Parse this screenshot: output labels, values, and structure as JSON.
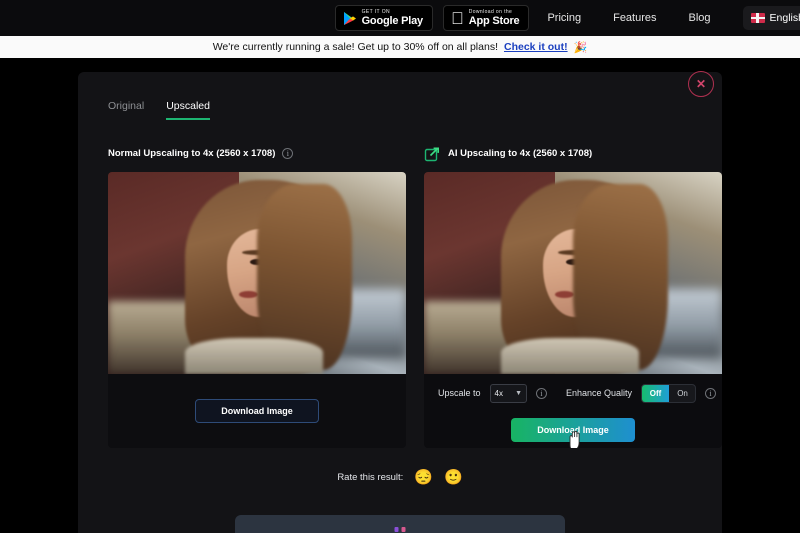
{
  "topnav": {
    "google_play": {
      "small": "GET IT ON",
      "big": "Google Play",
      "icon": "google-play-icon"
    },
    "app_store": {
      "small": "Download on the",
      "big": "App Store",
      "icon": "apple-icon"
    },
    "links": [
      "Pricing",
      "Features",
      "Blog"
    ],
    "language": {
      "label": "English",
      "flag": "uk-flag-icon"
    }
  },
  "banner": {
    "text": "We're currently running a sale! Get up to 30% off on all plans!",
    "link": "Check it out!",
    "emoji": "🎉"
  },
  "modal": {
    "close_label": "✕",
    "tabs": [
      {
        "label": "Original",
        "active": false
      },
      {
        "label": "Upscaled",
        "active": true
      }
    ],
    "left_panel": {
      "title": "Normal Upscaling to 4x (2560 x 1708)",
      "info": "i",
      "download_label": "Download Image"
    },
    "right_panel": {
      "icon": "ai-upscale-icon",
      "title": "AI Upscaling to 4x (2560 x 1708)",
      "upscale_label": "Upscale to",
      "upscale_value": "4x",
      "upscale_chevron": "▼",
      "upscale_info": "i",
      "enhance_label": "Enhance Quality",
      "enhance_off": "Off",
      "enhance_on": "On",
      "enhance_selected": "Off",
      "enhance_info": "i",
      "download_label": "Download Image"
    },
    "rate": {
      "label": "Rate this result:",
      "emoji_one": "😔",
      "emoji_two": "🙂"
    }
  },
  "colors": {
    "accent_green": "#18b463",
    "accent_blue": "#1e8fd0",
    "tab_underline": "#1db572",
    "close_red": "#d2456b",
    "banner_link": "#1a3fbf"
  }
}
